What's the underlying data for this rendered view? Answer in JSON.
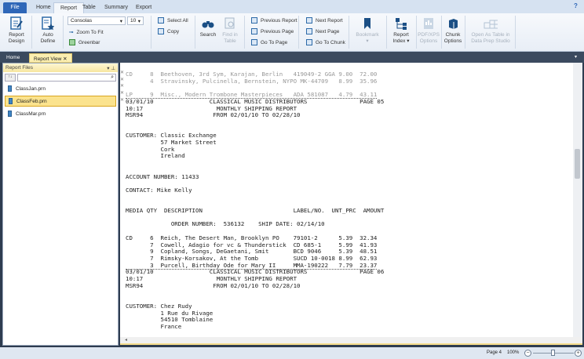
{
  "menu": {
    "tabs": [
      "File",
      "Home",
      "Report",
      "Table",
      "Summary",
      "Export"
    ],
    "active": "Report",
    "help": "?"
  },
  "ribbon": {
    "report_design": "Report Design",
    "auto_define": "Auto Define",
    "font": "Consolas",
    "font_size": "10",
    "zoom_to_fit": "Zoom To Fit",
    "greenbar": "Greenbar",
    "select_all": "Select All",
    "copy": "Copy",
    "search": "Search",
    "find_in_table": "Find in Table",
    "previous_report": "Previous Report",
    "previous_page": "Previous Page",
    "go_to_page": "Go To Page",
    "next_report": "Next Report",
    "next_page": "Next Page",
    "go_to_chunk": "Go To Chunk",
    "bookmark": "Bookmark",
    "report_index": "Report Index",
    "pdf_xps": "PDF/XPS Options",
    "chunk_options": "Chunk Options",
    "open_as_table": "Open As Table in Data Prep Studio"
  },
  "doc_tabs": [
    "Home",
    "Report View"
  ],
  "left_panel": {
    "title": "Report Files",
    "search_value": "",
    "files": [
      "ClassJan.prn",
      "ClassFeb.prn",
      "ClassMar.prn"
    ],
    "selected": "ClassFeb.prn"
  },
  "report": {
    "lines": [
      "CD     8  Beethoven, 3rd Sym, Karajan, Berlin   419049-2 GGA 9.00  72.00",
      "       4  Stravinsky, Pulcinella, Bernstein, NYPO MK-44709   8.99  35.96",
      "",
      "LP     9  Misc., Modern Trombone Masterpieces   ADA 581087   4.79  43.11",
      "03/01/10                CLASSICAL MUSIC DISTRIBUTORS               PAGE 05",
      "10:17                     MONTHLY SHIPPING REPORT",
      "MSR94                    FROM 02/01/10 TO 02/28/10",
      "",
      "",
      "CUSTOMER: Classic Exchange",
      "          57 Market Street",
      "          Cork",
      "          Ireland",
      "",
      "",
      "ACCOUNT NUMBER: 11433",
      "",
      "CONTACT: Mike Kelly",
      "",
      "",
      "MEDIA QTY  DESCRIPTION                          LABEL/NO.  UNT_PRC  AMOUNT",
      "",
      "             ORDER NUMBER:  536132    SHIP DATE: 02/14/10",
      "",
      "CD     6  Reich, The Desert Man, Brooklyn PO    79101-2      5.39  32.34",
      "       7  Cowell, Adagio for vc & Thunderstick  CD 685-1     5.99  41.93",
      "       9  Copland, Songs, DeGaetani, Smit       BCD 9046     5.39  48.51",
      "       7  Rimsky-Korsakov, At the Tomb          SUCD 10-0018 8.99  62.93",
      "       3  Purcell, Birthday Ode for Mary II     MMA-190222   7.79  23.37",
      "03/01/10                CLASSICAL MUSIC DISTRIBUTORS               PAGE 06",
      "10:17                     MONTHLY SHIPPING REPORT",
      "MSR94                    FROM 02/01/10 TO 02/28/10",
      "",
      "",
      "CUSTOMER: Chez Rudy",
      "          1 Rue du Rivage",
      "          54510 Tomblaine",
      "          France"
    ]
  },
  "status": {
    "page": "Page 4",
    "zoom": "100%",
    "zoom_level_percent": 100
  },
  "colors": {
    "file_tab": "#2f67b8",
    "selection": "#fbe38e",
    "dark_frame": "#2e3c50"
  }
}
